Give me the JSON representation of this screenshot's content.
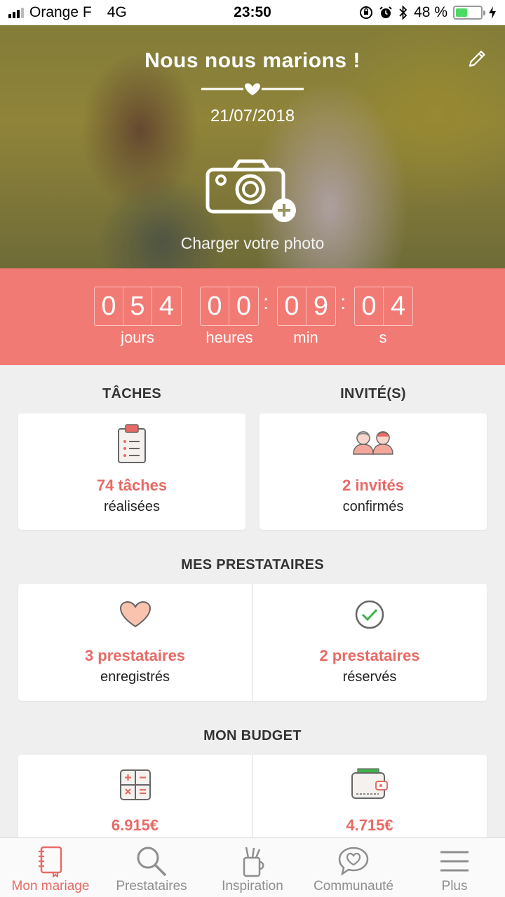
{
  "status_bar": {
    "carrier": "Orange F",
    "network": "4G",
    "time": "23:50",
    "battery_percent": "48 %",
    "battery_level": 0.48
  },
  "hero": {
    "title": "Nous nous marions !",
    "date": "21/07/2018",
    "photo_label": "Charger votre photo"
  },
  "countdown": {
    "days_digits": [
      "0",
      "5",
      "4"
    ],
    "hours_digits": [
      "0",
      "0"
    ],
    "minutes_digits": [
      "0",
      "9"
    ],
    "seconds_digits": [
      "0",
      "4"
    ],
    "days_label": "jours",
    "hours_label": "heures",
    "minutes_label": "min",
    "seconds_label": "s"
  },
  "tasks": {
    "title": "TÂCHES",
    "value": "74 tâches",
    "sub": "réalisées"
  },
  "guests": {
    "title": "INVITÉ(S)",
    "value": "2 invités",
    "sub": "confirmés"
  },
  "vendors": {
    "title": "MES PRESTATAIRES",
    "saved_value": "3 prestataires",
    "saved_sub": "enregistrés",
    "booked_value": "2 prestataires",
    "booked_sub": "réservés"
  },
  "budget": {
    "title": "MON BUDGET",
    "estimated": "6.915€",
    "spent": "4.715€"
  },
  "tabbar": {
    "items": [
      {
        "label": "Mon mariage",
        "icon": "notebook-icon",
        "active": true
      },
      {
        "label": "Prestataires",
        "icon": "search-icon",
        "active": false
      },
      {
        "label": "Inspiration",
        "icon": "pencil-cup-icon",
        "active": false
      },
      {
        "label": "Communauté",
        "icon": "chat-heart-icon",
        "active": false
      },
      {
        "label": "Plus",
        "icon": "menu-icon",
        "active": false
      }
    ]
  },
  "colors": {
    "accent": "#f27a74",
    "accent_text": "#e86a66",
    "background": "#efefef"
  }
}
